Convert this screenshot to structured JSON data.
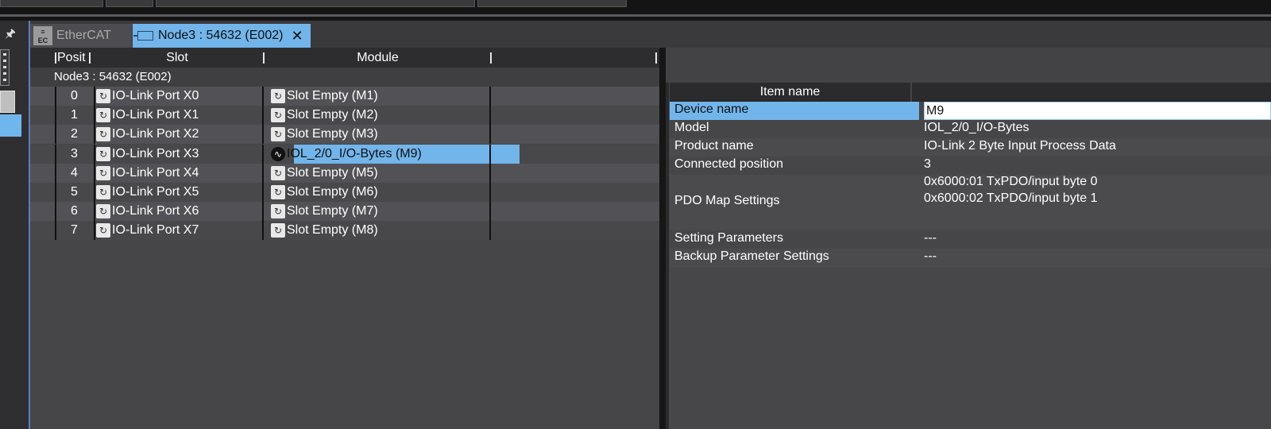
{
  "tabs": [
    {
      "label": "EtherCAT",
      "icon": "ethercat-icon"
    },
    {
      "label": "Node3 : 54632 (E002)",
      "icon": "document-icon"
    }
  ],
  "grid": {
    "columns": {
      "position": "Posit",
      "slot": "Slot",
      "module": "Module"
    },
    "node_title": "Node3 : 54632 (E002)",
    "rows": [
      {
        "pos": "0",
        "slot": "IO-Link Port X0",
        "module": "Slot Empty (M1)"
      },
      {
        "pos": "1",
        "slot": "IO-Link Port X1",
        "module": "Slot Empty (M2)"
      },
      {
        "pos": "2",
        "slot": "IO-Link Port X2",
        "module": "Slot Empty (M3)"
      },
      {
        "pos": "3",
        "slot": "IO-Link Port X3",
        "module": "IOL_2/0_I/O-Bytes (M9)"
      },
      {
        "pos": "4",
        "slot": "IO-Link Port X4",
        "module": "Slot Empty (M5)"
      },
      {
        "pos": "5",
        "slot": "IO-Link Port X5",
        "module": "Slot Empty (M6)"
      },
      {
        "pos": "6",
        "slot": "IO-Link Port X6",
        "module": "Slot Empty (M7)"
      },
      {
        "pos": "7",
        "slot": "IO-Link Port X7",
        "module": "Slot Empty (M8)"
      }
    ],
    "selected_row": 3
  },
  "properties": {
    "header": "Item name",
    "device_name_label": "Device name",
    "device_name_value": "M9",
    "model_label": "Model",
    "model_value": "IOL_2/0_I/O-Bytes",
    "product_name_label": "Product name",
    "product_name_value": "IO-Link 2 Byte Input Process Data",
    "connected_position_label": "Connected position",
    "connected_position_value": "3",
    "pdo_map_label": "PDO Map Settings",
    "pdo_map_values": [
      "0x6000:01 TxPDO/input byte 0",
      "0x6000:02 TxPDO/input byte 1"
    ],
    "setting_params_label": "Setting Parameters",
    "setting_params_value": "---",
    "backup_params_label": "Backup Parameter Settings",
    "backup_params_value": "---"
  },
  "colors": {
    "selection": "#72b5ea",
    "background": "#454548",
    "header": "#2d2d2f"
  }
}
